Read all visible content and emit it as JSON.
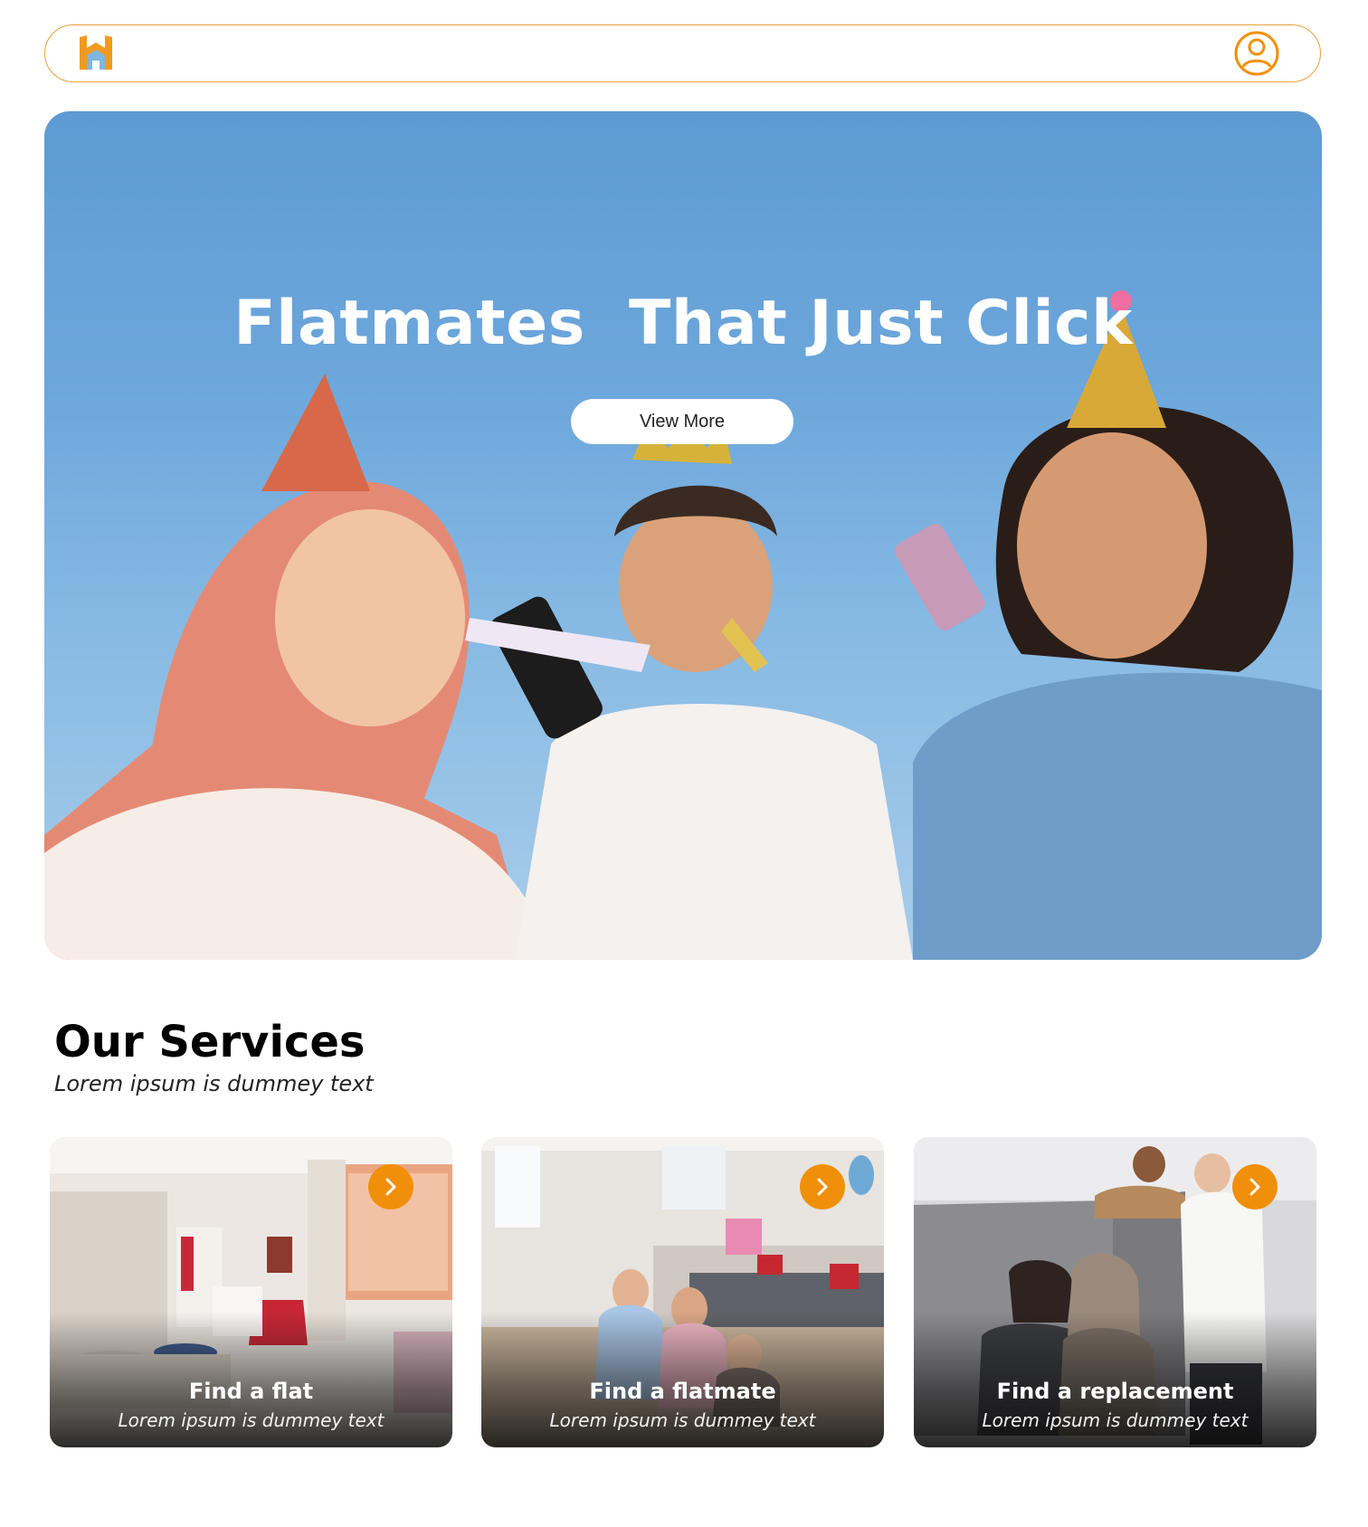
{
  "colors": {
    "accent": "#f0900a",
    "navbar_border": "#e9a13a",
    "logo_orange": "#f29a1f",
    "logo_blue": "#7fb6de"
  },
  "navbar": {
    "logo_icon": "house-h-logo-icon",
    "user_icon": "user-circle-icon"
  },
  "hero": {
    "title": "Flatmates  That Just Click",
    "button_label": "View More"
  },
  "services": {
    "heading": "Our Services",
    "subheading": "Lorem ipsum is dummey text",
    "cards": [
      {
        "title": "Find a flat",
        "subtitle": "Lorem ipsum is dummey text",
        "icon": "chevron-right-icon"
      },
      {
        "title": "Find a flatmate",
        "subtitle": "Lorem ipsum is dummey text",
        "icon": "chevron-right-icon"
      },
      {
        "title": "Find a replacement",
        "subtitle": "Lorem ipsum is dummey text",
        "icon": "chevron-right-icon"
      }
    ]
  }
}
